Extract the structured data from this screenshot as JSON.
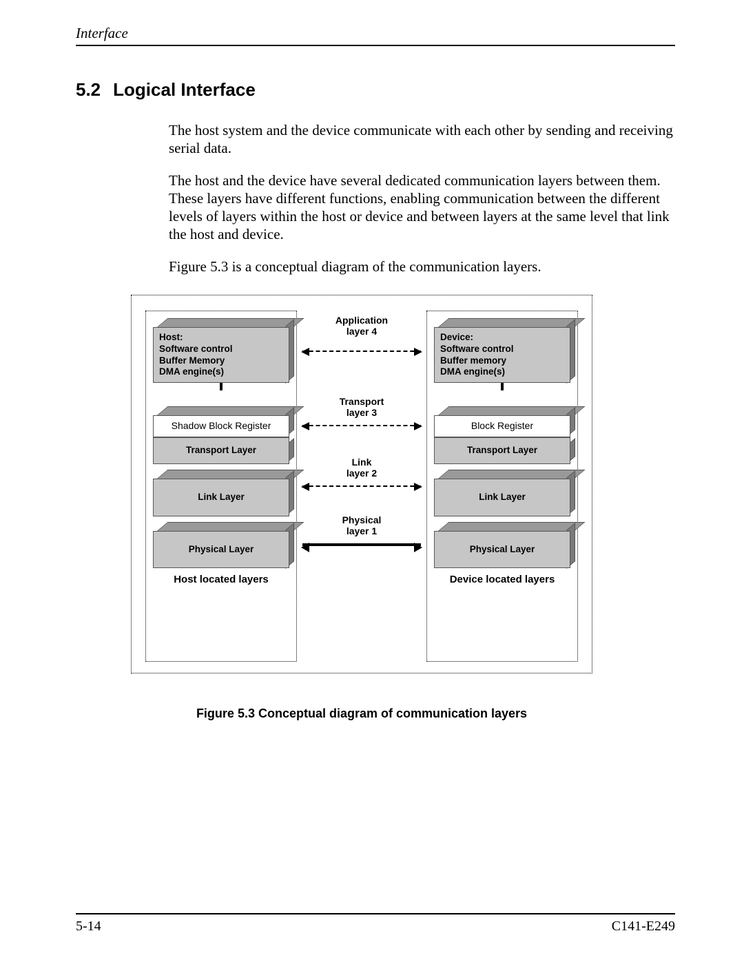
{
  "header": {
    "running": "Interface"
  },
  "section": {
    "number": "5.2",
    "title": "Logical Interface"
  },
  "paragraphs": {
    "p1": "The host system and the device communicate with each other by sending and receiving serial data.",
    "p2": "The host and the device have several dedicated communication layers between them.  These layers have different functions, enabling communication between the different levels of layers within the host or device and between layers at the same level that link the host and device.",
    "p3": "Figure 5.3 is a conceptual diagram of the communication layers."
  },
  "diagram": {
    "mid_labels": {
      "l4a": "Application",
      "l4b": "layer 4",
      "l3a": "Transport",
      "l3b": "layer 3",
      "l2a": "Link",
      "l2b": "layer 2",
      "l1a": "Physical",
      "l1b": "layer 1"
    },
    "host": {
      "app_l1": "Host:",
      "app_l2": "Software control",
      "app_l3": "Buffer Memory",
      "app_l4": "DMA engine(s)",
      "reg": "Shadow Block Register",
      "transport": "Transport Layer",
      "link": "Link Layer",
      "phys": "Physical Layer",
      "caption": "Host located layers"
    },
    "device": {
      "app_l1": "Device:",
      "app_l2": "Software control",
      "app_l3": "Buffer memory",
      "app_l4": "DMA engine(s)",
      "reg": "Block Register",
      "transport": "Transport Layer",
      "link": "Link Layer",
      "phys": "Physical Layer",
      "caption": "Device located layers"
    }
  },
  "figure_caption": "Figure 5.3  Conceptual diagram of communication layers",
  "footer": {
    "page": "5-14",
    "doc": "C141-E249"
  }
}
